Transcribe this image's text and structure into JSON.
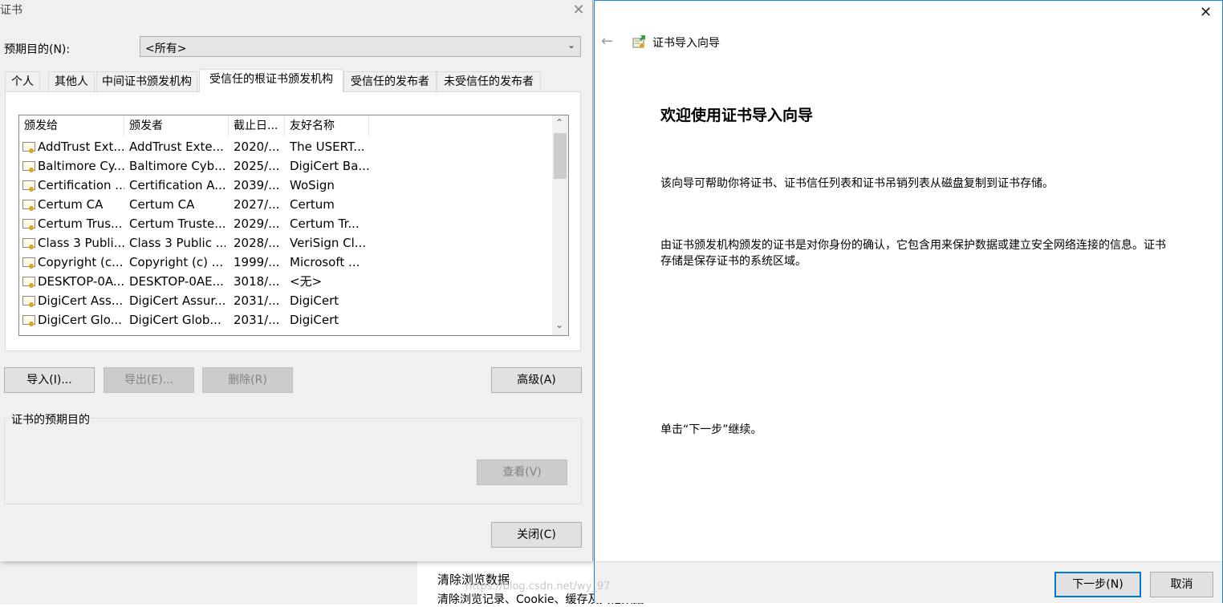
{
  "background": {
    "line1": "清除浏览数据",
    "line2": "清除浏览记录、Cookie、缓存及其他数据"
  },
  "cert_dialog": {
    "title": "证书",
    "purpose_label": "预期目的(N):",
    "purpose_value": "<所有>",
    "tabs": [
      "个人",
      "其他人",
      "中间证书颁发机构",
      "受信任的根证书颁发机构",
      "受信任的发布者",
      "未受信任的发布者"
    ],
    "active_tab": "受信任的根证书颁发机构",
    "columns": [
      "颁发给",
      "颁发者",
      "截止日...",
      "友好名称"
    ],
    "rows": [
      [
        "AddTrust Ext...",
        "AddTrust Exte...",
        "2020/...",
        "The USERT..."
      ],
      [
        "Baltimore Cy...",
        "Baltimore Cyb...",
        "2025/...",
        "DigiCert Ba..."
      ],
      [
        "Certification ...",
        "Certification A...",
        "2039/...",
        "WoSign"
      ],
      [
        "Certum CA",
        "Certum CA",
        "2027/...",
        "Certum"
      ],
      [
        "Certum Trus...",
        "Certum Truste...",
        "2029/...",
        "Certum Tr..."
      ],
      [
        "Class 3 Publi...",
        "Class 3 Public ...",
        "2028/...",
        "VeriSign Cl..."
      ],
      [
        "Copyright (c...",
        "Copyright (c) ...",
        "1999/...",
        "Microsoft ..."
      ],
      [
        "DESKTOP-0A...",
        "DESKTOP-0AE...",
        "3018/...",
        "<无>"
      ],
      [
        "DigiCert Ass...",
        "DigiCert Assur...",
        "2031/...",
        "DigiCert"
      ],
      [
        "DigiCert Glo...",
        "DigiCert Glob...",
        "2031/...",
        "DigiCert"
      ]
    ],
    "buttons": {
      "import": "导入(I)...",
      "export": "导出(E)...",
      "delete": "删除(R)",
      "advanced": "高级(A)",
      "view": "查看(V)",
      "close": "关闭(C)"
    },
    "purposes_group_label": "证书的预期目的"
  },
  "wizard": {
    "title": "证书导入向导",
    "heading": "欢迎使用证书导入向导",
    "para1": "该向导可帮助你将证书、证书信任列表和证书吊销列表从磁盘复制到证书存储。",
    "para2": "由证书颁发机构颁发的证书是对你身份的确认，它包含用来保护数据或建立安全网络连接的信息。证书存储是保存证书的系统区域。",
    "para3": "单击“下一步”继续。",
    "next_button": "下一步(N)",
    "cancel_button": "取消",
    "watermark": "https://blog.csdn.net/wy_97"
  },
  "icons": {
    "back": "arrow-left-icon",
    "close": "close-icon",
    "certificate": "certificate-icon",
    "wizard": "certificate-import-icon"
  }
}
